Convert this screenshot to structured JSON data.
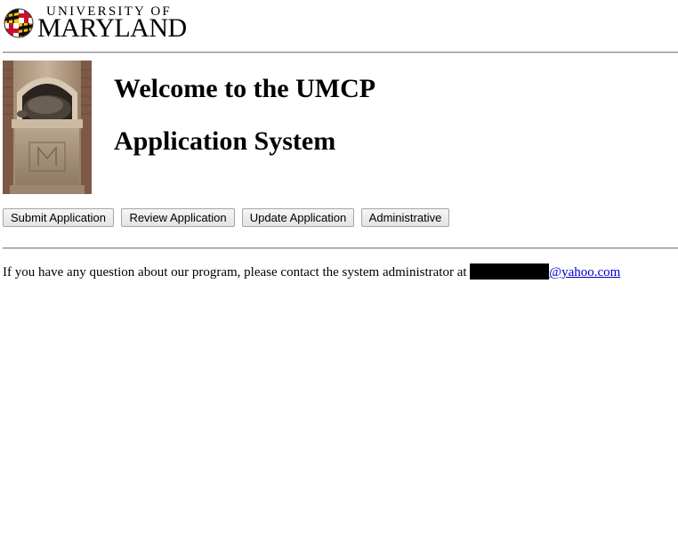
{
  "logo": {
    "line1": "UNIVERSITY OF",
    "line2": "MARYLAND",
    "icon": "maryland-flag-globe-icon"
  },
  "photo": {
    "icon": "testudo-statue-photo"
  },
  "heading": {
    "line1": "Welcome to the UMCP",
    "line2": "Application System"
  },
  "buttons": {
    "submit": "Submit Application",
    "review": "Review Application",
    "update": "Update Application",
    "admin": "Administrative"
  },
  "contact": {
    "text": "If you have any question about our program, please contact the system administrator at ",
    "email_visible": "@yahoo.com"
  },
  "colors": {
    "link": "#0000cc",
    "rule": "#8a8a8a",
    "maryland_red": "#c8102e",
    "maryland_gold": "#f5c518"
  }
}
